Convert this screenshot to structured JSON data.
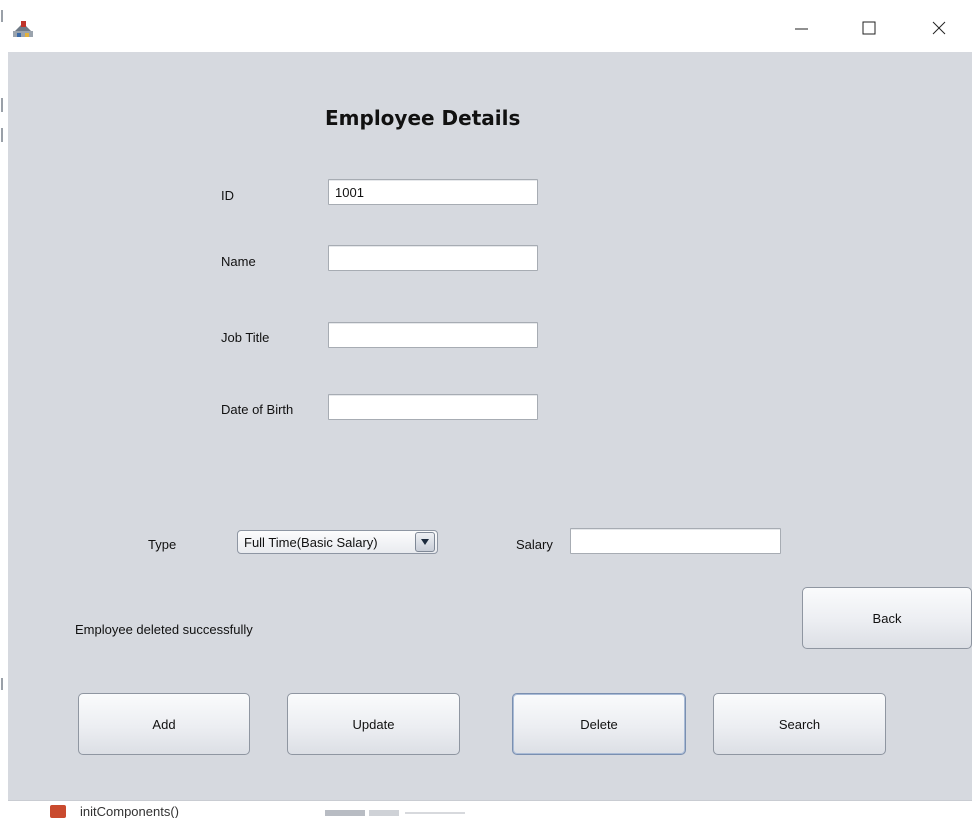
{
  "window": {
    "controls": {
      "minimize_icon": "minimize-icon",
      "maximize_icon": "maximize-icon",
      "close_icon": "close-icon"
    }
  },
  "form": {
    "title": "Employee Details",
    "fields": {
      "id": {
        "label": "ID",
        "value": "1001"
      },
      "name": {
        "label": "Name",
        "value": ""
      },
      "job_title": {
        "label": "Job Title",
        "value": ""
      },
      "dob": {
        "label": "Date of Birth",
        "value": ""
      }
    },
    "type": {
      "label": "Type",
      "selected": "Full Time(Basic Salary)"
    },
    "salary": {
      "label": "Salary",
      "value": ""
    },
    "status_message": "Employee deleted successfully",
    "buttons": {
      "back": "Back",
      "add": "Add",
      "update": "Update",
      "delete": "Delete",
      "search": "Search"
    }
  },
  "background": {
    "taskbar_text": "initComponents()"
  },
  "colors": {
    "window_bg": "#d6d9df",
    "titlebar_bg": "#ffffff"
  }
}
